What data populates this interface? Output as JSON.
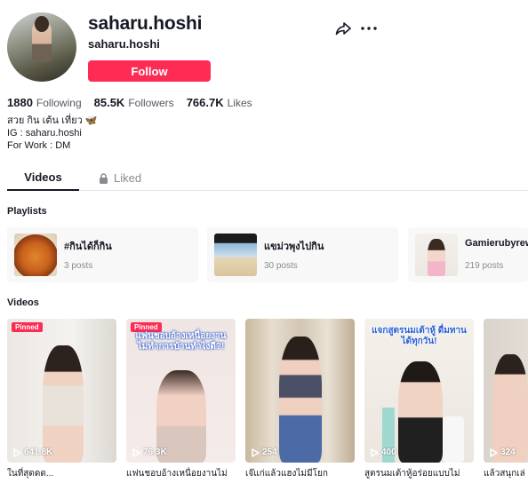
{
  "profile": {
    "username": "saharu.hoshi",
    "nickname": "saharu.hoshi",
    "follow_label": "Follow",
    "stats": [
      {
        "value": "1880",
        "label": "Following"
      },
      {
        "value": "85.5K",
        "label": "Followers"
      },
      {
        "value": "766.7K",
        "label": "Likes"
      }
    ],
    "bio": [
      "สวย กิน เต้น เที่ยว 🦋",
      "IG : saharu.hoshi",
      "For Work : DM"
    ]
  },
  "tabs": {
    "videos": "Videos",
    "liked": "Liked"
  },
  "playlists": {
    "title": "Playlists",
    "items": [
      {
        "name": "#กินได้ก็กิน",
        "count": "3 posts"
      },
      {
        "name": "แขม่วพุงไปกิน",
        "count": "30 posts"
      },
      {
        "name": "Gamierubyrew",
        "count": "219 posts"
      }
    ]
  },
  "videos": {
    "title": "Videos",
    "pinned_label": "Pinned",
    "items": [
      {
        "views": "641.8K",
        "caption": "ในที่สุดดด...",
        "pinned": true
      },
      {
        "views": "76.3K",
        "caption": "แฟนชอบอ้างเหนื่อยงานไม่",
        "pinned": true,
        "overlay": "แฟนชอบอ้างเหนื่อยงาน ไม่ทำการบ้านทำไงดี?!"
      },
      {
        "views": "254",
        "caption": "เจ๊แก่แล้วแฮงไม่มีโยก",
        "pinned": false
      },
      {
        "views": "400",
        "caption": "สูตรนมเต้าหู้อร่อยแบบไม่",
        "pinned": false,
        "overlay": "แจกสูตรนมเต้าหู้ ดื่มทานได้ทุกวัน!"
      },
      {
        "views": "324",
        "caption": "แล้วสนุกเล่",
        "pinned": false
      }
    ]
  },
  "colors": {
    "accent": "#fe2c55",
    "text": "#161823",
    "muted": "#8a8b91"
  },
  "icons": [
    "share-icon",
    "more-icon",
    "lock-icon",
    "play-icon"
  ]
}
